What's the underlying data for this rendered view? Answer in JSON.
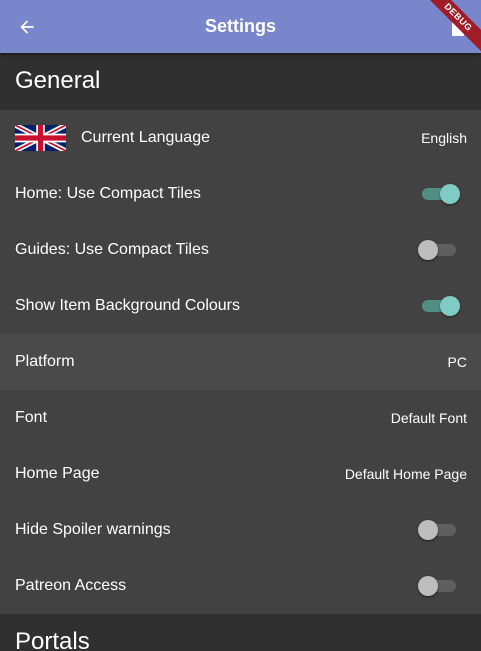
{
  "appbar": {
    "title": "Settings",
    "back_icon": "arrow-left-icon",
    "action_icon": "trash-icon",
    "color": "#7986cb"
  },
  "debug_banner": {
    "label": "DEBUG",
    "color": "#a01c26"
  },
  "sections": {
    "general": {
      "title": "General",
      "items": [
        {
          "label": "Current Language",
          "value": "English",
          "icon": "uk-flag-icon"
        },
        {
          "label": "Home: Use Compact Tiles",
          "toggle": true
        },
        {
          "label": "Guides: Use Compact Tiles",
          "toggle": false
        },
        {
          "label": "Show Item Background Colours",
          "toggle": true
        },
        {
          "label": "Platform",
          "value": "PC"
        },
        {
          "label": "Font",
          "value": "Default Font"
        },
        {
          "label": "Home Page",
          "value": "Default Home Page"
        },
        {
          "label": "Hide Spoiler warnings",
          "toggle": false
        },
        {
          "label": "Patreon Access",
          "toggle": false
        }
      ]
    },
    "portals": {
      "title": "Portals"
    }
  },
  "colors": {
    "background": "#303030",
    "row": "#424242",
    "switch_on": "#80cbc4",
    "switch_off": "#bdbdbd"
  }
}
